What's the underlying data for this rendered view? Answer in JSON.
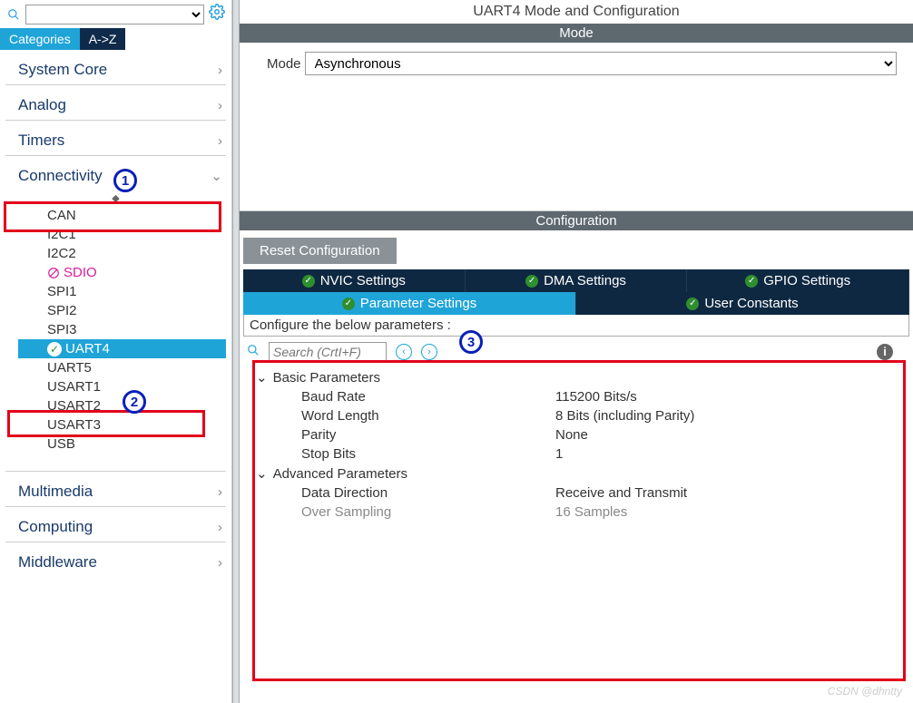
{
  "sidebar": {
    "tabs": {
      "categories": "Categories",
      "az": "A->Z"
    },
    "categories": [
      {
        "label": "System Core",
        "expanded": false
      },
      {
        "label": "Analog",
        "expanded": false
      },
      {
        "label": "Timers",
        "expanded": false
      },
      {
        "label": "Connectivity",
        "expanded": true
      },
      {
        "label": "Multimedia",
        "expanded": false
      },
      {
        "label": "Computing",
        "expanded": false
      },
      {
        "label": "Middleware",
        "expanded": false
      }
    ],
    "connectivity_items": [
      {
        "label": "CAN",
        "status": "normal"
      },
      {
        "label": "I2C1",
        "status": "normal"
      },
      {
        "label": "I2C2",
        "status": "normal"
      },
      {
        "label": "SDIO",
        "status": "disabled"
      },
      {
        "label": "SPI1",
        "status": "normal"
      },
      {
        "label": "SPI2",
        "status": "normal"
      },
      {
        "label": "SPI3",
        "status": "normal"
      },
      {
        "label": "UART4",
        "status": "selected"
      },
      {
        "label": "UART5",
        "status": "normal"
      },
      {
        "label": "USART1",
        "status": "normal"
      },
      {
        "label": "USART2",
        "status": "normal"
      },
      {
        "label": "USART3",
        "status": "normal"
      },
      {
        "label": "USB",
        "status": "normal"
      }
    ]
  },
  "main": {
    "title": "UART4 Mode and Configuration",
    "mode_bar": "Mode",
    "mode_label": "Mode",
    "mode_value": "Asynchronous",
    "config_bar": "Configuration",
    "reset_label": "Reset Configuration",
    "tabs_top": [
      {
        "label": "NVIC Settings"
      },
      {
        "label": "DMA Settings"
      },
      {
        "label": "GPIO Settings"
      }
    ],
    "tabs_bottom": [
      {
        "label": "Parameter Settings",
        "active": true
      },
      {
        "label": "User Constants",
        "active": false
      }
    ],
    "configure_text": "Configure the below parameters :",
    "search_placeholder": "Search (CrtI+F)",
    "groups": [
      {
        "name": "Basic Parameters",
        "params": [
          {
            "name": "Baud Rate",
            "value": "115200 Bits/s"
          },
          {
            "name": "Word Length",
            "value": "8 Bits (including Parity)"
          },
          {
            "name": "Parity",
            "value": "None"
          },
          {
            "name": "Stop Bits",
            "value": "1"
          }
        ]
      },
      {
        "name": "Advanced Parameters",
        "params": [
          {
            "name": "Data Direction",
            "value": "Receive and Transmit"
          },
          {
            "name": "Over Sampling",
            "value": "16 Samples",
            "dim": true
          }
        ]
      }
    ]
  },
  "annotations": {
    "step1": "1",
    "step2": "2",
    "step3": "3"
  },
  "watermark": "CSDN @dhntty"
}
